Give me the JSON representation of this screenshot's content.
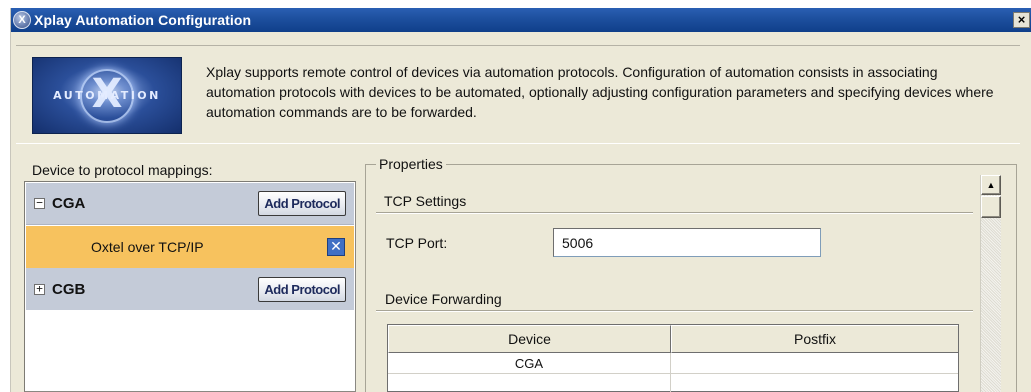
{
  "window": {
    "title": "Xplay Automation Configuration",
    "close_label": "×"
  },
  "header": {
    "logo_letter": "X",
    "logo_text": "AUTOMATION",
    "description": "Xplay supports remote control of devices via automation protocols.  Configuration of automation consists in associating automation protocols with devices to be automated, optionally adjusting configuration parameters and specifying devices where automation commands are to be forwarded."
  },
  "mappings": {
    "label": "Device to protocol mappings:",
    "devices": [
      {
        "name": "CGA",
        "expanded": true,
        "expander": "−",
        "add_label": "Add Protocol",
        "protocols": [
          {
            "name": "Oxtel over TCP/IP",
            "remove_icon": "close-icon"
          }
        ]
      },
      {
        "name": "CGB",
        "expanded": false,
        "expander": "+",
        "add_label": "Add Protocol",
        "protocols": []
      }
    ]
  },
  "properties": {
    "legend": "Properties",
    "tcp_section": "TCP Settings",
    "tcp_port_label": "TCP Port:",
    "tcp_port_value": "5006",
    "forwarding_section": "Device Forwarding",
    "table": {
      "columns": [
        "Device",
        "Postfix"
      ],
      "rows": [
        [
          "CGA",
          ""
        ],
        [
          "",
          ""
        ]
      ]
    }
  },
  "colors": {
    "titlebar": "#1d4f9e",
    "device_row": "#c4cbd8",
    "selected_protocol_row": "#f7c25e",
    "window_bg": "#ece9d8"
  }
}
